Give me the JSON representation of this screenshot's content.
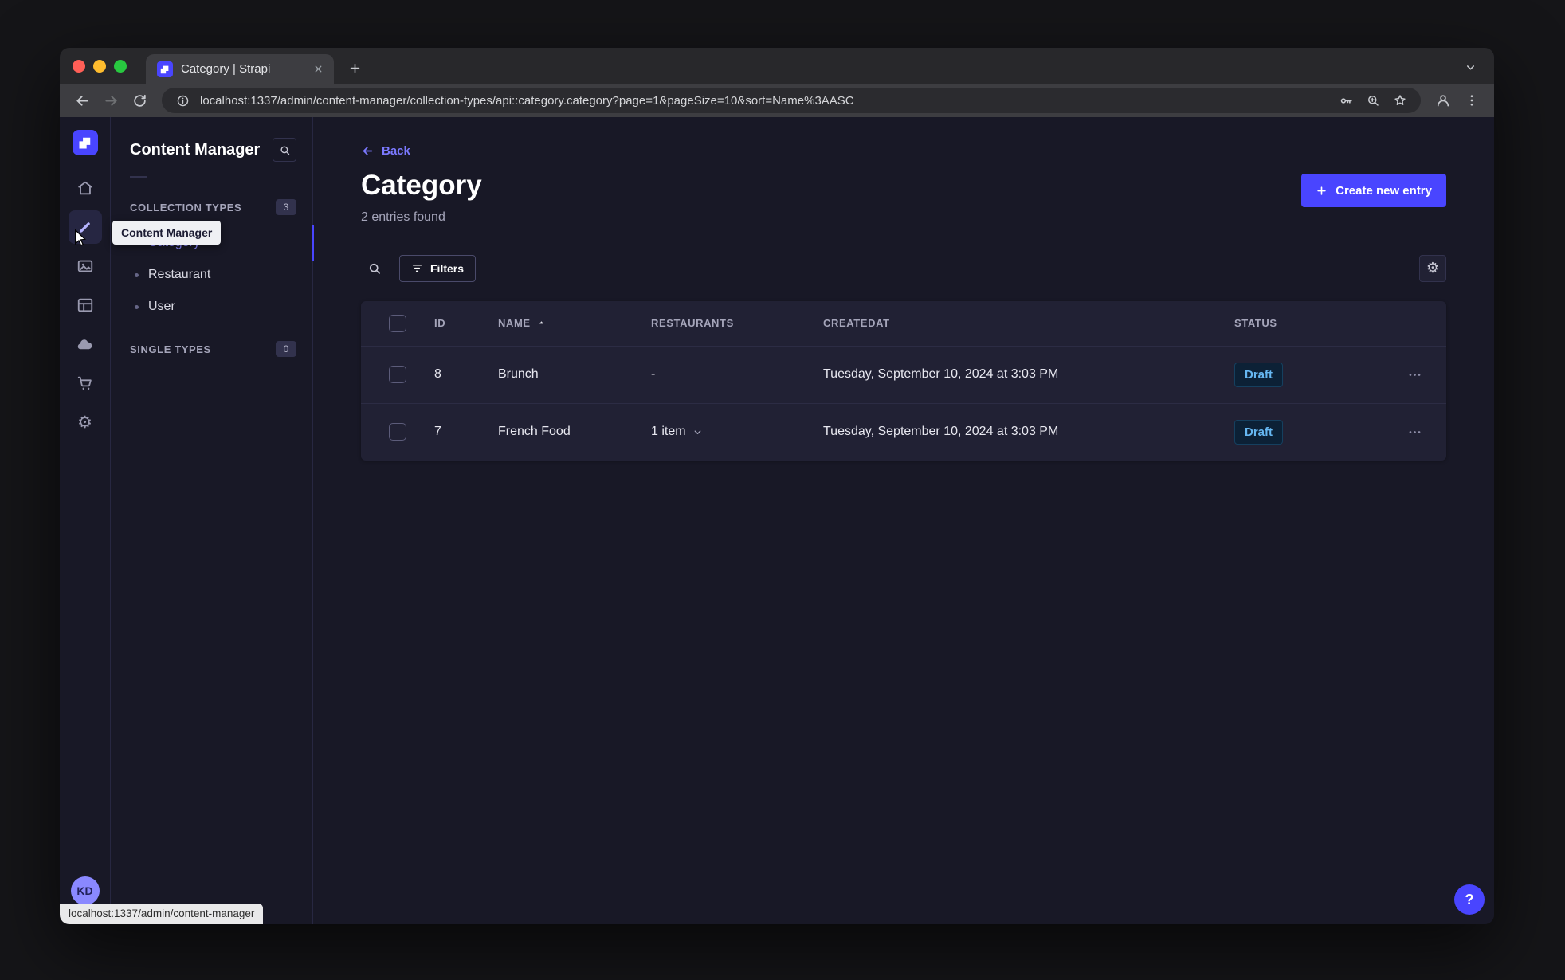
{
  "browser": {
    "tab_title": "Category | Strapi",
    "url": "localhost:1337/admin/content-manager/collection-types/api::category.category?page=1&pageSize=10&sort=Name%3AASC",
    "status_text": "localhost:1337/admin/content-manager"
  },
  "rail": {
    "tooltip": "Content Manager",
    "items": [
      "home",
      "content-manager",
      "media-library",
      "content-type-builder",
      "deploy",
      "marketplace",
      "settings"
    ],
    "avatar_initials": "KD"
  },
  "subnav": {
    "title": "Content Manager",
    "collection_types": {
      "label": "COLLECTION TYPES",
      "badge": "3",
      "items": [
        "Category",
        "Restaurant",
        "User"
      ],
      "active_item": "Category"
    },
    "single_types": {
      "label": "SINGLE TYPES",
      "badge": "0"
    }
  },
  "main": {
    "back": "Back",
    "title": "Category",
    "subtitle": "2 entries found",
    "create_button": "Create new entry",
    "filters_button": "Filters",
    "table": {
      "headers": {
        "id": "ID",
        "name": "NAME",
        "restaurants": "RESTAURANTS",
        "createdat": "CREATEDAT",
        "status": "STATUS"
      },
      "sort_column": "NAME",
      "sort_direction": "asc",
      "rows": [
        {
          "id": "8",
          "name": "Brunch",
          "restaurants": "-",
          "createdat": "Tuesday, September 10, 2024 at 3:03 PM",
          "status": "Draft"
        },
        {
          "id": "7",
          "name": "French Food",
          "restaurants": "1 item",
          "createdat": "Tuesday, September 10, 2024 at 3:03 PM",
          "status": "Draft"
        }
      ]
    },
    "help_label": "?"
  },
  "colors": {
    "primary": "#4945ff",
    "link": "#7b79ff",
    "app_bg": "#181826",
    "card_bg": "#212134",
    "draft_text": "#66b7f1",
    "draft_bg": "#0c2136",
    "traffic_red": "#ff5f57",
    "traffic_yellow": "#febc2e",
    "traffic_green": "#28c840"
  },
  "icons": {
    "search": "magnifier",
    "home": "house",
    "content-manager": "pencil",
    "media-library": "picture",
    "content-type-builder": "grid",
    "deploy": "cloud",
    "marketplace": "cart",
    "settings": "⚙",
    "filter": "funnel",
    "plus": "+",
    "back-arrow": "←",
    "forward-arrow": "→",
    "reload": "circular-arrow",
    "chevron-down": "▾",
    "sort-asc": "▲",
    "more-horizontal": "⋯",
    "more-vertical": "⋮",
    "close": "✕",
    "info": "ⓘ",
    "key": "key",
    "zoom-in": "magnifier-plus",
    "star": "☆",
    "profile": "person",
    "help": "?"
  }
}
